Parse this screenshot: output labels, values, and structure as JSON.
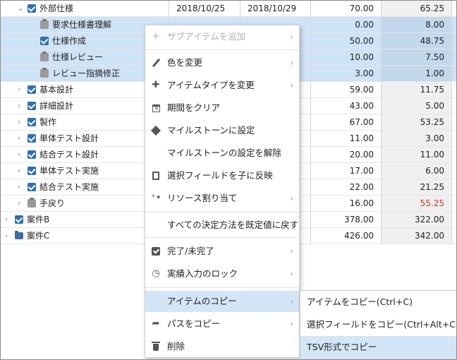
{
  "rows": [
    {
      "id": "gaibu",
      "indent": 0,
      "chev": "open",
      "icon": "check",
      "name": "外部仕様",
      "start": "2018/10/25",
      "end": "2018/10/29",
      "v1": "70.00",
      "v2": "65.25",
      "v2red": false,
      "sel": false
    },
    {
      "id": "req",
      "indent": 2,
      "chev": "",
      "icon": "clip",
      "name": "要求仕様書理解",
      "start": "",
      "end": "",
      "v1": "0.00",
      "v2": "8.00",
      "v2red": false,
      "sel": true
    },
    {
      "id": "spec",
      "indent": 2,
      "chev": "",
      "icon": "check",
      "name": "仕様作成",
      "start": "",
      "end": "",
      "v1": "50.00",
      "v2": "48.75",
      "v2red": false,
      "sel": true
    },
    {
      "id": "review",
      "indent": 2,
      "chev": "",
      "icon": "clip",
      "name": "仕様レビュー",
      "start": "",
      "end": "",
      "v1": "10.00",
      "v2": "7.50",
      "v2red": false,
      "sel": true
    },
    {
      "id": "fix",
      "indent": 2,
      "chev": "",
      "icon": "clip",
      "name": "レビュー指摘修正",
      "start": "",
      "end": "",
      "v1": "3.00",
      "v2": "1.00",
      "v2red": false,
      "sel": true
    },
    {
      "id": "kihon",
      "indent": 1,
      "chev": "closed",
      "icon": "check",
      "name": "基本設計",
      "start": "",
      "end": "",
      "v1": "59.00",
      "v2": "11.75",
      "v2red": false,
      "sel": false
    },
    {
      "id": "shosai",
      "indent": 1,
      "chev": "closed",
      "icon": "check",
      "name": "詳細設計",
      "start": "",
      "end": "",
      "v1": "43.00",
      "v2": "5.00",
      "v2red": false,
      "sel": false
    },
    {
      "id": "seisaku",
      "indent": 1,
      "chev": "closed",
      "icon": "check",
      "name": "製作",
      "start": "",
      "end": "",
      "v1": "67.00",
      "v2": "53.25",
      "v2red": false,
      "sel": false
    },
    {
      "id": "ut-design",
      "indent": 1,
      "chev": "closed",
      "icon": "check",
      "name": "単体テスト設計",
      "start": "",
      "end": "",
      "v1": "11.00",
      "v2": "3.00",
      "v2red": false,
      "sel": false
    },
    {
      "id": "it-design",
      "indent": 1,
      "chev": "closed",
      "icon": "check",
      "name": "結合テスト設計",
      "start": "",
      "end": "",
      "v1": "20.00",
      "v2": "11.00",
      "v2red": false,
      "sel": false
    },
    {
      "id": "ut-run",
      "indent": 1,
      "chev": "closed",
      "icon": "check",
      "name": "単体テスト実施",
      "start": "",
      "end": "",
      "v1": "17.00",
      "v2": "6.00",
      "v2red": false,
      "sel": false
    },
    {
      "id": "it-run",
      "indent": 1,
      "chev": "closed",
      "icon": "check",
      "name": "結合テスト実施",
      "start": "",
      "end": "",
      "v1": "22.00",
      "v2": "21.25",
      "v2red": false,
      "sel": false
    },
    {
      "id": "rework",
      "indent": 1,
      "chev": "closed",
      "icon": "clip",
      "name": "手戻り",
      "start": "",
      "end": "",
      "v1": "16.00",
      "v2": "55.25",
      "v2red": true,
      "sel": false
    },
    {
      "id": "caseB",
      "indent": 0,
      "chev": "closed",
      "icon": "check",
      "name": "案件B",
      "start": "",
      "end": "",
      "v1": "378.00",
      "v2": "322.00",
      "v2red": false,
      "sel": false
    },
    {
      "id": "caseC",
      "indent": 0,
      "chev": "closed",
      "icon": "folder",
      "name": "案件C",
      "start": "",
      "end": "",
      "v1": "426.00",
      "v2": "342.00",
      "v2red": false,
      "sel": false
    }
  ],
  "menu": {
    "add_sub": "サブアイテムを追加",
    "color": "色を変更",
    "type": "アイテムタイプを変更",
    "clear_period": "期間をクリア",
    "set_milestone": "マイルストーンに設定",
    "unset_milestone": "マイルストーンの設定を解除",
    "reflect": "選択フィールドを子に反映",
    "resource": "リソース割り当て",
    "reset": "すべての決定方法を既定値に戻す",
    "done": "完了/未完了",
    "lock": "実績入力のロック",
    "copy_item": "アイテムのコピー",
    "copy_path": "パスをコピー",
    "delete": "削除"
  },
  "submenu": {
    "copy_item": "アイテムをコピー(Ctrl+C)",
    "copy_fields": "選択フィールドをコピー(Ctrl+Alt+C)",
    "copy_tsv": "TSV形式でコピー"
  },
  "colors": {
    "selection": "#cfe3f6",
    "accent": "#2f6fb3",
    "over_budget": "#d9302c"
  }
}
